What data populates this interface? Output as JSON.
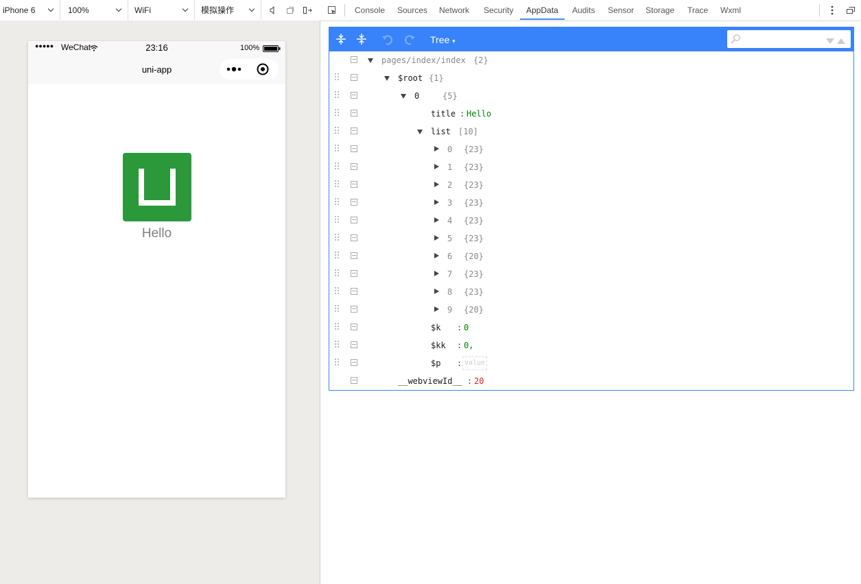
{
  "toolbar": {
    "device": "iPhone 6",
    "zoom": "100%",
    "network": "WiFi",
    "operation": "模拟操作",
    "tabs": [
      "Console",
      "Sources",
      "Network",
      "Security",
      "AppData",
      "Audits",
      "Sensor",
      "Storage",
      "Trace",
      "Wxml"
    ],
    "active_tab": "AppData"
  },
  "phone": {
    "status_dots": "●●●●●",
    "carrier": "WeChat",
    "time": "23:16",
    "battery": "100%",
    "nav_title": "uni-app",
    "hello_text": "Hello",
    "logo_color": "#2b9939"
  },
  "appdata": {
    "mode": "Tree",
    "header_color": "#3883fa",
    "rows": [
      {
        "key": "pages/index/index",
        "count": "{2}",
        "expand": "down"
      },
      {
        "key": "$root",
        "count": "{1}",
        "expand": "down"
      },
      {
        "key": "0",
        "count": "{5}",
        "expand": "down"
      },
      {
        "key": "title",
        "value": "Hello",
        "value_type": "string"
      },
      {
        "key": "list",
        "count": "[10]",
        "expand": "down"
      },
      {
        "key": "0",
        "count": "{23}",
        "expand": "right"
      },
      {
        "key": "1",
        "count": "{23}",
        "expand": "right"
      },
      {
        "key": "2",
        "count": "{23}",
        "expand": "right"
      },
      {
        "key": "3",
        "count": "{23}",
        "expand": "right"
      },
      {
        "key": "4",
        "count": "{23}",
        "expand": "right"
      },
      {
        "key": "5",
        "count": "{23}",
        "expand": "right"
      },
      {
        "key": "6",
        "count": "{20}",
        "expand": "right"
      },
      {
        "key": "7",
        "count": "{23}",
        "expand": "right"
      },
      {
        "key": "8",
        "count": "{23}",
        "expand": "right"
      },
      {
        "key": "9",
        "count": "{20}",
        "expand": "right"
      },
      {
        "key": "$k",
        "value": "0",
        "value_type": "string"
      },
      {
        "key": "$kk",
        "value": "0,",
        "value_type": "string"
      },
      {
        "key": "$p",
        "value": "value",
        "value_type": "empty"
      },
      {
        "key": "__webviewId__",
        "value": "20",
        "value_type": "number"
      }
    ]
  }
}
